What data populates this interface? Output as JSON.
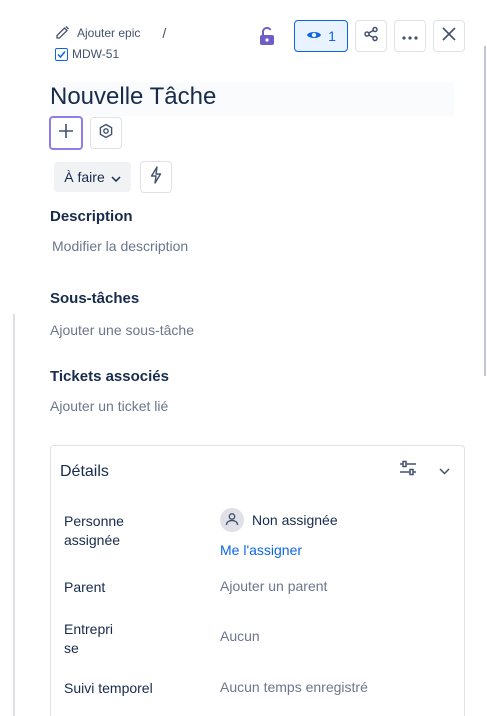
{
  "breadcrumb": {
    "epic_label": "Ajouter epic",
    "separator": "/",
    "issue_key": "MDW-51"
  },
  "toolbar": {
    "watch_count": "1"
  },
  "issue": {
    "title": "Nouvelle Tâche",
    "status": "À faire"
  },
  "description": {
    "heading": "Description",
    "placeholder": "Modifier la description"
  },
  "subtasks": {
    "heading": "Sous-tâches",
    "placeholder": "Ajouter une sous-tâche"
  },
  "linked": {
    "heading": "Tickets associés",
    "placeholder": "Ajouter un ticket lié"
  },
  "details": {
    "heading": "Détails",
    "assignee_label": "Personne assignée",
    "assignee_value": "Non assignée",
    "assign_me": "Me l'assigner",
    "parent_label": "Parent",
    "parent_value": "Ajouter un parent",
    "company_label": "Entreprise",
    "company_value": "Aucun",
    "time_label": "Suivi temporel",
    "time_value": "Aucun temps enregistré"
  },
  "colors": {
    "accent": "#0c66e4",
    "lock": "#6e5dc6",
    "focus": "#8f7ee7"
  },
  "icons": [
    "edit-icon",
    "checkbox-icon",
    "unlock-icon",
    "eye-icon",
    "share-icon",
    "more-icon",
    "close-icon",
    "plus-icon",
    "gear-icon",
    "chevron-down-icon",
    "bolt-icon",
    "sliders-icon",
    "user-icon"
  ]
}
